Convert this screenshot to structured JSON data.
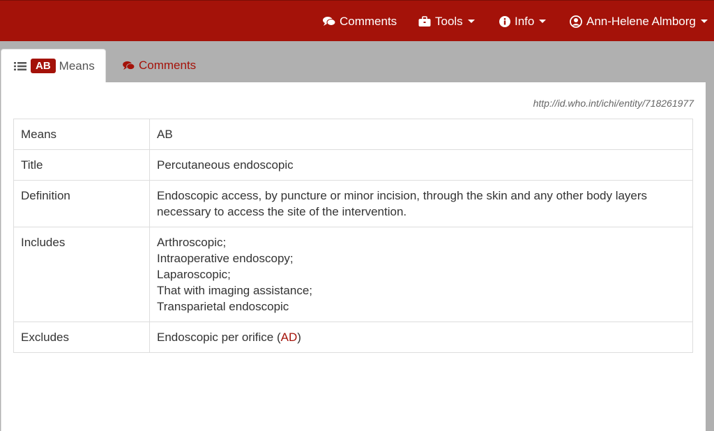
{
  "navbar": {
    "comments_label": "Comments",
    "tools_label": "Tools",
    "info_label": "Info",
    "user_label": "Ann-Helene Almborg"
  },
  "tabs": {
    "active": {
      "badge": "AB",
      "label": "Means"
    },
    "comments_label": "Comments"
  },
  "entity_uri": "http://id.who.int/ichi/entity/718261977",
  "table": {
    "means": {
      "key": "Means",
      "value": "AB"
    },
    "title": {
      "key": "Title",
      "value": "Percutaneous endoscopic"
    },
    "definition": {
      "key": "Definition",
      "value": "Endoscopic access, by puncture or minor incision, through the skin and any other body layers necessary to access the site of the intervention."
    },
    "includes": {
      "key": "Includes",
      "items": [
        "Arthroscopic;",
        "Intraoperative endoscopy;",
        "Laparoscopic;",
        "That with imaging assistance;",
        "Transparietal endoscopic"
      ]
    },
    "excludes": {
      "key": "Excludes",
      "text_before": "Endoscopic per orifice (",
      "link": "AD",
      "text_after": ")"
    }
  },
  "colors": {
    "brand": "#a41209",
    "background": "#b0b0b0"
  },
  "icons": [
    "comments-icon",
    "briefcase-icon",
    "info-circle-icon",
    "user-circle-icon",
    "list-icon"
  ]
}
